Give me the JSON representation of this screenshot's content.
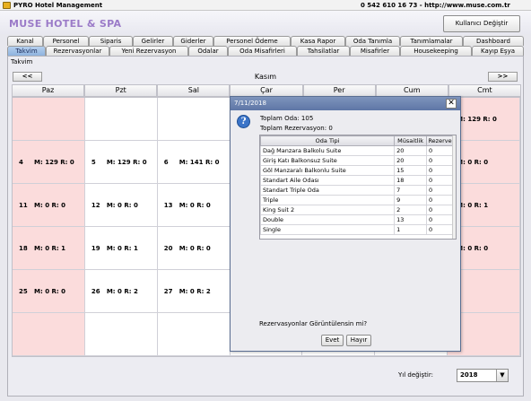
{
  "window": {
    "title": "PYRO Hotel Management",
    "contact": "0 542 610 16 73  -  http://www.muse.com.tr"
  },
  "header": {
    "hotel_name": "MUSE HOTEL & SPA",
    "change_user_label": "Kullanıcı Değiştir"
  },
  "tabs_top": [
    {
      "label": "Kanal"
    },
    {
      "label": "Personel"
    },
    {
      "label": "Siparis"
    },
    {
      "label": "Gelirler"
    },
    {
      "label": "Giderler"
    },
    {
      "label": "Personel Ödeme"
    },
    {
      "label": "Kasa Rapor"
    },
    {
      "label": "Oda Tanımla"
    },
    {
      "label": "Tanımlamalar"
    },
    {
      "label": "Dashboard"
    }
  ],
  "tabs_bottom": [
    {
      "label": "Takvim",
      "active": true
    },
    {
      "label": "Rezervasyonlar",
      "active": false
    },
    {
      "label": "Yeni Rezervasyon",
      "active": false
    },
    {
      "label": "Odalar",
      "active": false
    },
    {
      "label": "Oda Misafirleri",
      "active": false
    },
    {
      "label": "Tahsilatlar",
      "active": false
    },
    {
      "label": "Misafirler",
      "active": false
    },
    {
      "label": "Housekeeping",
      "active": false
    },
    {
      "label": "Kayıp Eşya",
      "active": false
    }
  ],
  "calendar": {
    "panel_label": "Takvim",
    "prev_label": "<<",
    "next_label": ">>",
    "month": "Kasım",
    "days": [
      "Paz",
      "Pzt",
      "Sal",
      "Çar",
      "Per",
      "Cum",
      "Cmt"
    ],
    "rows": [
      [
        {
          "d": "",
          "s": ""
        },
        {
          "d": "",
          "s": ""
        },
        {
          "d": "",
          "s": ""
        },
        {
          "d": "",
          "s": ""
        },
        {
          "d": "",
          "s": ""
        },
        {
          "d": "",
          "s": ""
        },
        {
          "d": "",
          "s": "M: 129 R: 0"
        }
      ],
      [
        {
          "d": "4",
          "s": "M: 129 R: 0"
        },
        {
          "d": "5",
          "s": "M: 129 R: 0"
        },
        {
          "d": "6",
          "s": "M: 141 R: 0"
        },
        {
          "d": "",
          "s": ""
        },
        {
          "d": "",
          "s": ""
        },
        {
          "d": "",
          "s": ""
        },
        {
          "d": "",
          "s": "M: 0 R: 0"
        }
      ],
      [
        {
          "d": "11",
          "s": "M: 0 R: 0"
        },
        {
          "d": "12",
          "s": "M: 0 R: 0"
        },
        {
          "d": "13",
          "s": "M: 0 R: 0"
        },
        {
          "d": "",
          "s": ""
        },
        {
          "d": "",
          "s": ""
        },
        {
          "d": "",
          "s": ""
        },
        {
          "d": "",
          "s": "M: 0 R: 1"
        }
      ],
      [
        {
          "d": "18",
          "s": "M: 0 R: 1"
        },
        {
          "d": "19",
          "s": "M: 0 R: 1"
        },
        {
          "d": "20",
          "s": "M: 0 R: 0"
        },
        {
          "d": "",
          "s": ""
        },
        {
          "d": "",
          "s": ""
        },
        {
          "d": "",
          "s": ""
        },
        {
          "d": "",
          "s": "M: 0 R: 0"
        }
      ],
      [
        {
          "d": "25",
          "s": "M: 0 R: 0"
        },
        {
          "d": "26",
          "s": "M: 0 R: 2"
        },
        {
          "d": "27",
          "s": "M: 0 R: 2"
        },
        {
          "d": "",
          "s": ""
        },
        {
          "d": "",
          "s": ""
        },
        {
          "d": "",
          "s": ""
        },
        {
          "d": "",
          "s": ""
        }
      ],
      [
        {
          "d": "",
          "s": ""
        },
        {
          "d": "",
          "s": ""
        },
        {
          "d": "",
          "s": ""
        },
        {
          "d": "",
          "s": ""
        },
        {
          "d": "",
          "s": ""
        },
        {
          "d": "",
          "s": ""
        },
        {
          "d": "",
          "s": ""
        }
      ]
    ],
    "year_label": "Yıl değiştir:",
    "year_value": "2018"
  },
  "dialog": {
    "title": "7/11/2018",
    "close_label": "✕",
    "info_glyph": "?",
    "total_rooms": "Toplam Oda:  105",
    "total_reservations": "Toplam Rezervasyon:  0",
    "columns": [
      "Oda Tipi",
      "Müsaitlik",
      "Rezerve"
    ],
    "rows": [
      [
        "Dağ Manzara Balkolu Suite",
        "20",
        "0"
      ],
      [
        "Giriş Katı Balkonsuz Suite",
        "20",
        "0"
      ],
      [
        "Göl Manzaralı Balkonlu Suite",
        "15",
        "0"
      ],
      [
        "Standart Aile Odası",
        "18",
        "0"
      ],
      [
        "Standart Triple Oda",
        "7",
        "0"
      ],
      [
        "Triple",
        "9",
        "0"
      ],
      [
        "King Suit 2",
        "2",
        "0"
      ],
      [
        "Double",
        "13",
        "0"
      ],
      [
        "Single",
        "1",
        "0"
      ]
    ],
    "question": "Rezervasyonlar Görüntülensin mi?",
    "yes_label": "Evet",
    "no_label": "Hayır"
  },
  "colors": {
    "weekend_bg": "#fbdcdc",
    "active_tab": "#a6c4e8",
    "dialog_titlebar": "#6d84b2",
    "hotel_name": "#9b7bc8"
  }
}
